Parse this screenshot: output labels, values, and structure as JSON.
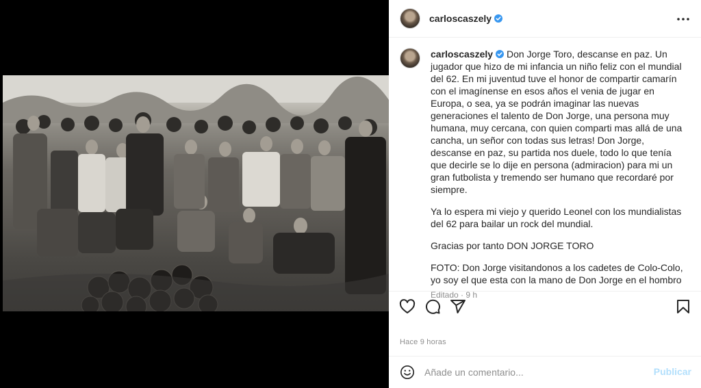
{
  "post": {
    "username": "carloscaszely",
    "photo_alt": "Fotografía en blanco y negro de un grupo de jóvenes futbolistas con balones"
  },
  "caption": {
    "username": "carloscaszely",
    "paragraphs": [
      "Don Jorge Toro, descanse en paz. Un jugador que hizo de mi infancia un niño feliz con el mundial del 62. En mi juventud tuve el honor de compartir camarín con el imagínense en esos años el venia de jugar en Europa, o sea, ya se podrán imaginar las nuevas generaciones el talento de Don Jorge, una persona muy humana, muy cercana, con quien comparti mas allá de una cancha, un señor con todas sus letras! Don Jorge, descanse en paz, su partida nos duele, todo lo que tenía que decirle se lo dije en persona (admiracion) para mi un gran futbolista y tremendo ser humano que recordaré por siempre.",
      "Ya lo espera mi viejo y querido Leonel con los mundialistas del 62 para bailar un rock del mundial.",
      "Gracias por tanto DON JORGE TORO",
      "FOTO: Don Jorge visitandonos a los cadetes de Colo-Colo, yo soy el que esta con la mano de Don Jorge en el hombro"
    ],
    "edited_label": "Editado · 9 h"
  },
  "footer": {
    "time_ago": "Hace 9 horas",
    "comment_placeholder": "Añade un comentario...",
    "post_button": "Publicar"
  },
  "icons": {
    "verified": "verified-badge-icon",
    "more": "more-options-icon",
    "like": "heart-icon",
    "comment": "comment-icon",
    "share": "share-icon",
    "save": "bookmark-icon",
    "emoji": "emoji-icon"
  },
  "colors": {
    "verified": "#3897f0",
    "post_button_disabled": "#b2dffc",
    "muted": "#8e8e8e"
  }
}
